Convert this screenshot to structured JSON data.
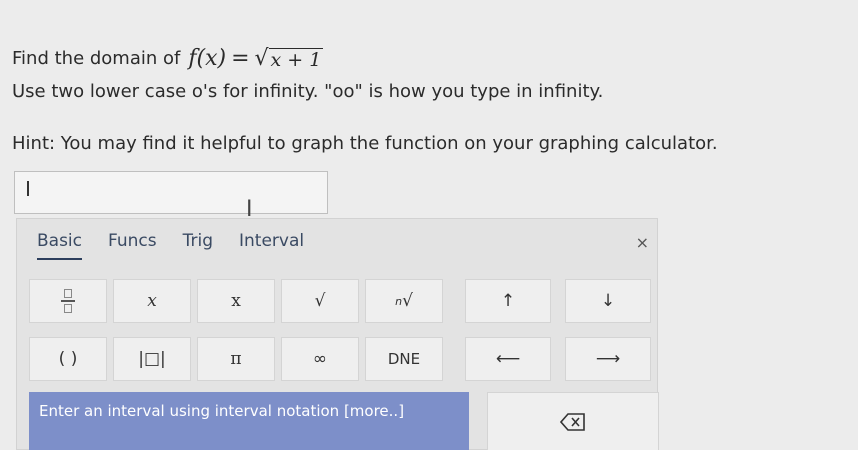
{
  "question": {
    "prefix": "Find the domain of",
    "function_name": "f(x)",
    "equals": "=",
    "radical": "√",
    "radicand": "x + 1",
    "instruction": "Use two lower case o's for infinity. \"oo\" is how you type in infinity.",
    "hint": "Hint: You may find it helpful to graph the function on your graphing calculator."
  },
  "answer": {
    "value": ""
  },
  "keypad": {
    "tabs": [
      "Basic",
      "Funcs",
      "Trig",
      "Interval"
    ],
    "active_tab": "Basic",
    "close_label": "×",
    "row1": [
      "fraction",
      "x",
      "x",
      "√",
      "ⁿ√",
      "↑",
      "↓"
    ],
    "row1_labels": {
      "var_italic": "x",
      "var_plain": "x",
      "sqrt": "√",
      "nroot_n": "n",
      "nroot": "√",
      "up": "↑",
      "down": "↓"
    },
    "row2_labels": {
      "parens": "( )",
      "abs": "|□|",
      "pi": "π",
      "infinity": "∞",
      "dne": "DNE",
      "left": "⟵",
      "right": "⟶"
    },
    "enter_text": "Enter an interval using interval notation [more..]"
  }
}
